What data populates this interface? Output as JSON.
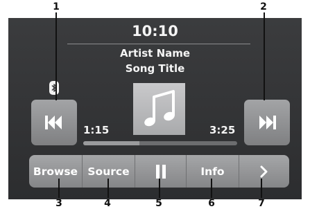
{
  "header": {
    "time": "10:10"
  },
  "now_playing": {
    "artist": "Artist Name",
    "song": "Song Title",
    "elapsed": "1:15",
    "duration": "3:25",
    "progress_fraction": 0.366,
    "album_art_icon": "music-note-icon"
  },
  "controls": {
    "prev_icon": "skip-previous-icon",
    "next_icon": "skip-next-icon",
    "bluetooth_icon": "bluetooth-icon"
  },
  "bottom_bar": {
    "browse_label": "Browse",
    "source_label": "Source",
    "pause_icon": "pause-icon",
    "info_label": "Info",
    "more_icon": "chevron-right-icon"
  },
  "callouts": [
    "1",
    "2",
    "3",
    "4",
    "5",
    "6",
    "7"
  ],
  "colors": {
    "screen_bg": "#333436",
    "button_face": "#959698",
    "text": "#f4f4f4"
  }
}
